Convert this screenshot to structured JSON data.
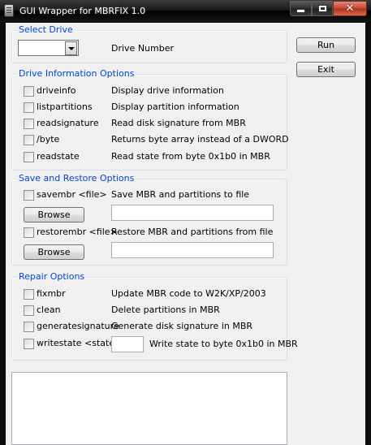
{
  "window": {
    "title": "GUI Wrapper for MBRFIX 1.0",
    "close_glyph": "✕"
  },
  "select_drive": {
    "title": "Select Drive",
    "drive_value": "",
    "label": "Drive Number"
  },
  "buttons": {
    "run": "Run",
    "exit": "Exit",
    "browse": "Browse"
  },
  "drive_info": {
    "title": "Drive Information Options",
    "options": [
      {
        "option": "driveinfo",
        "desc": "Display drive information",
        "checked": false
      },
      {
        "option": "listpartitions",
        "desc": "Display partition information",
        "checked": false
      },
      {
        "option": "readsignature",
        "desc": "Read disk signature from MBR",
        "checked": false
      },
      {
        "option": "/byte",
        "desc": "Returns byte array instead of a DWORD",
        "checked": false
      },
      {
        "option": "readstate",
        "desc": "Read state from byte 0x1b0 in MBR",
        "checked": false
      }
    ]
  },
  "save_restore": {
    "title": "Save and Restore Options",
    "save_option": "savembr <file>",
    "save_desc": "Save MBR and partitions to file",
    "save_path": "",
    "restore_option": "restorembr <file>",
    "restore_desc": "Restore MBR and partitions from file",
    "restore_path": ""
  },
  "repair": {
    "title": "Repair Options",
    "options": [
      {
        "option": "fixmbr",
        "desc": "Update MBR code to W2K/XP/2003",
        "checked": false
      },
      {
        "option": "clean",
        "desc": "Delete partitions in MBR",
        "checked": false
      },
      {
        "option": "generatesignature",
        "desc": "Generate disk signature in MBR",
        "checked": false
      }
    ],
    "writestate_option": "writestate <state>",
    "writestate_value": "",
    "writestate_desc": "Write state to byte 0x1b0 in MBR"
  },
  "output": {
    "text": ""
  },
  "colors": {
    "group_title": "#0046d5",
    "client_bg": "#f0f0f0"
  }
}
